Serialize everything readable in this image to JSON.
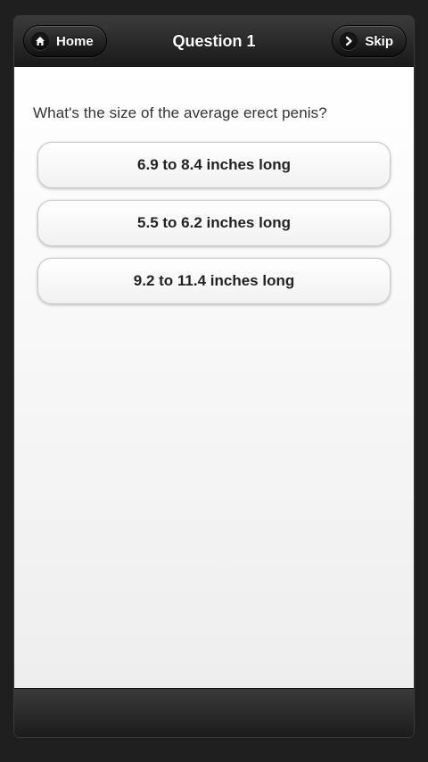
{
  "header": {
    "title": "Question 1",
    "home_label": "Home",
    "skip_label": "Skip",
    "home_icon": "home-icon",
    "skip_icon": "chevron-right-icon"
  },
  "main": {
    "question": "What's the size of the average erect penis?",
    "answers": [
      {
        "label": "6.9 to 8.4 inches long"
      },
      {
        "label": "5.5 to 6.2 inches long"
      },
      {
        "label": "9.2 to 11.4 inches long"
      }
    ]
  },
  "colors": {
    "header_bg": "#1a1a1a",
    "content_bg": "#f2f2f2",
    "text": "#333333"
  }
}
